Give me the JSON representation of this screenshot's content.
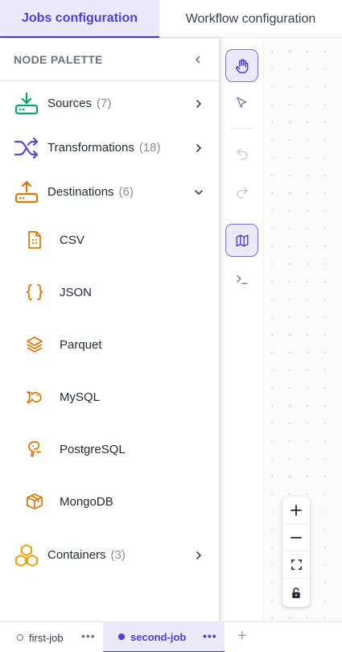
{
  "tabs": {
    "jobs_label": "Jobs configuration",
    "workflow_label": "Workflow configuration"
  },
  "palette": {
    "title": "NODE PALETTE",
    "categories": [
      {
        "label": "Sources",
        "count": "(7)",
        "icon": "download-icon",
        "color": "#0e9f6e",
        "expanded": false
      },
      {
        "label": "Transformations",
        "count": "(18)",
        "icon": "shuffle-icon",
        "color": "#5b48d9",
        "expanded": false
      },
      {
        "label": "Destinations",
        "count": "(6)",
        "icon": "upload-icon",
        "color": "#d97706",
        "expanded": true
      },
      {
        "label": "Containers",
        "count": "(3)",
        "icon": "boxes-icon",
        "color": "#f59e0b",
        "expanded": false
      }
    ],
    "destinations": [
      {
        "label": "CSV",
        "icon": "csv-file-icon"
      },
      {
        "label": "JSON",
        "icon": "json-braces-icon"
      },
      {
        "label": "Parquet",
        "icon": "layers-icon"
      },
      {
        "label": "MySQL",
        "icon": "mysql-dolphin-icon"
      },
      {
        "label": "PostgreSQL",
        "icon": "postgres-elephant-icon"
      },
      {
        "label": "MongoDB",
        "icon": "mongodb-box-icon"
      }
    ]
  },
  "toolbar": {
    "tools": [
      "hand-icon",
      "pointer-icon",
      "undo-icon",
      "redo-icon",
      "map-icon",
      "terminal-icon"
    ]
  },
  "zoom": {
    "controls": [
      "zoom-in-icon",
      "zoom-out-icon",
      "fit-view-icon",
      "lock-icon"
    ]
  },
  "jobs": [
    {
      "label": "first-job",
      "active": false
    },
    {
      "label": "second-job",
      "active": true
    }
  ],
  "colors": {
    "accent": "#4b3fd6",
    "accent_bg": "#ece9fb",
    "destination_orange": "#d97706"
  }
}
